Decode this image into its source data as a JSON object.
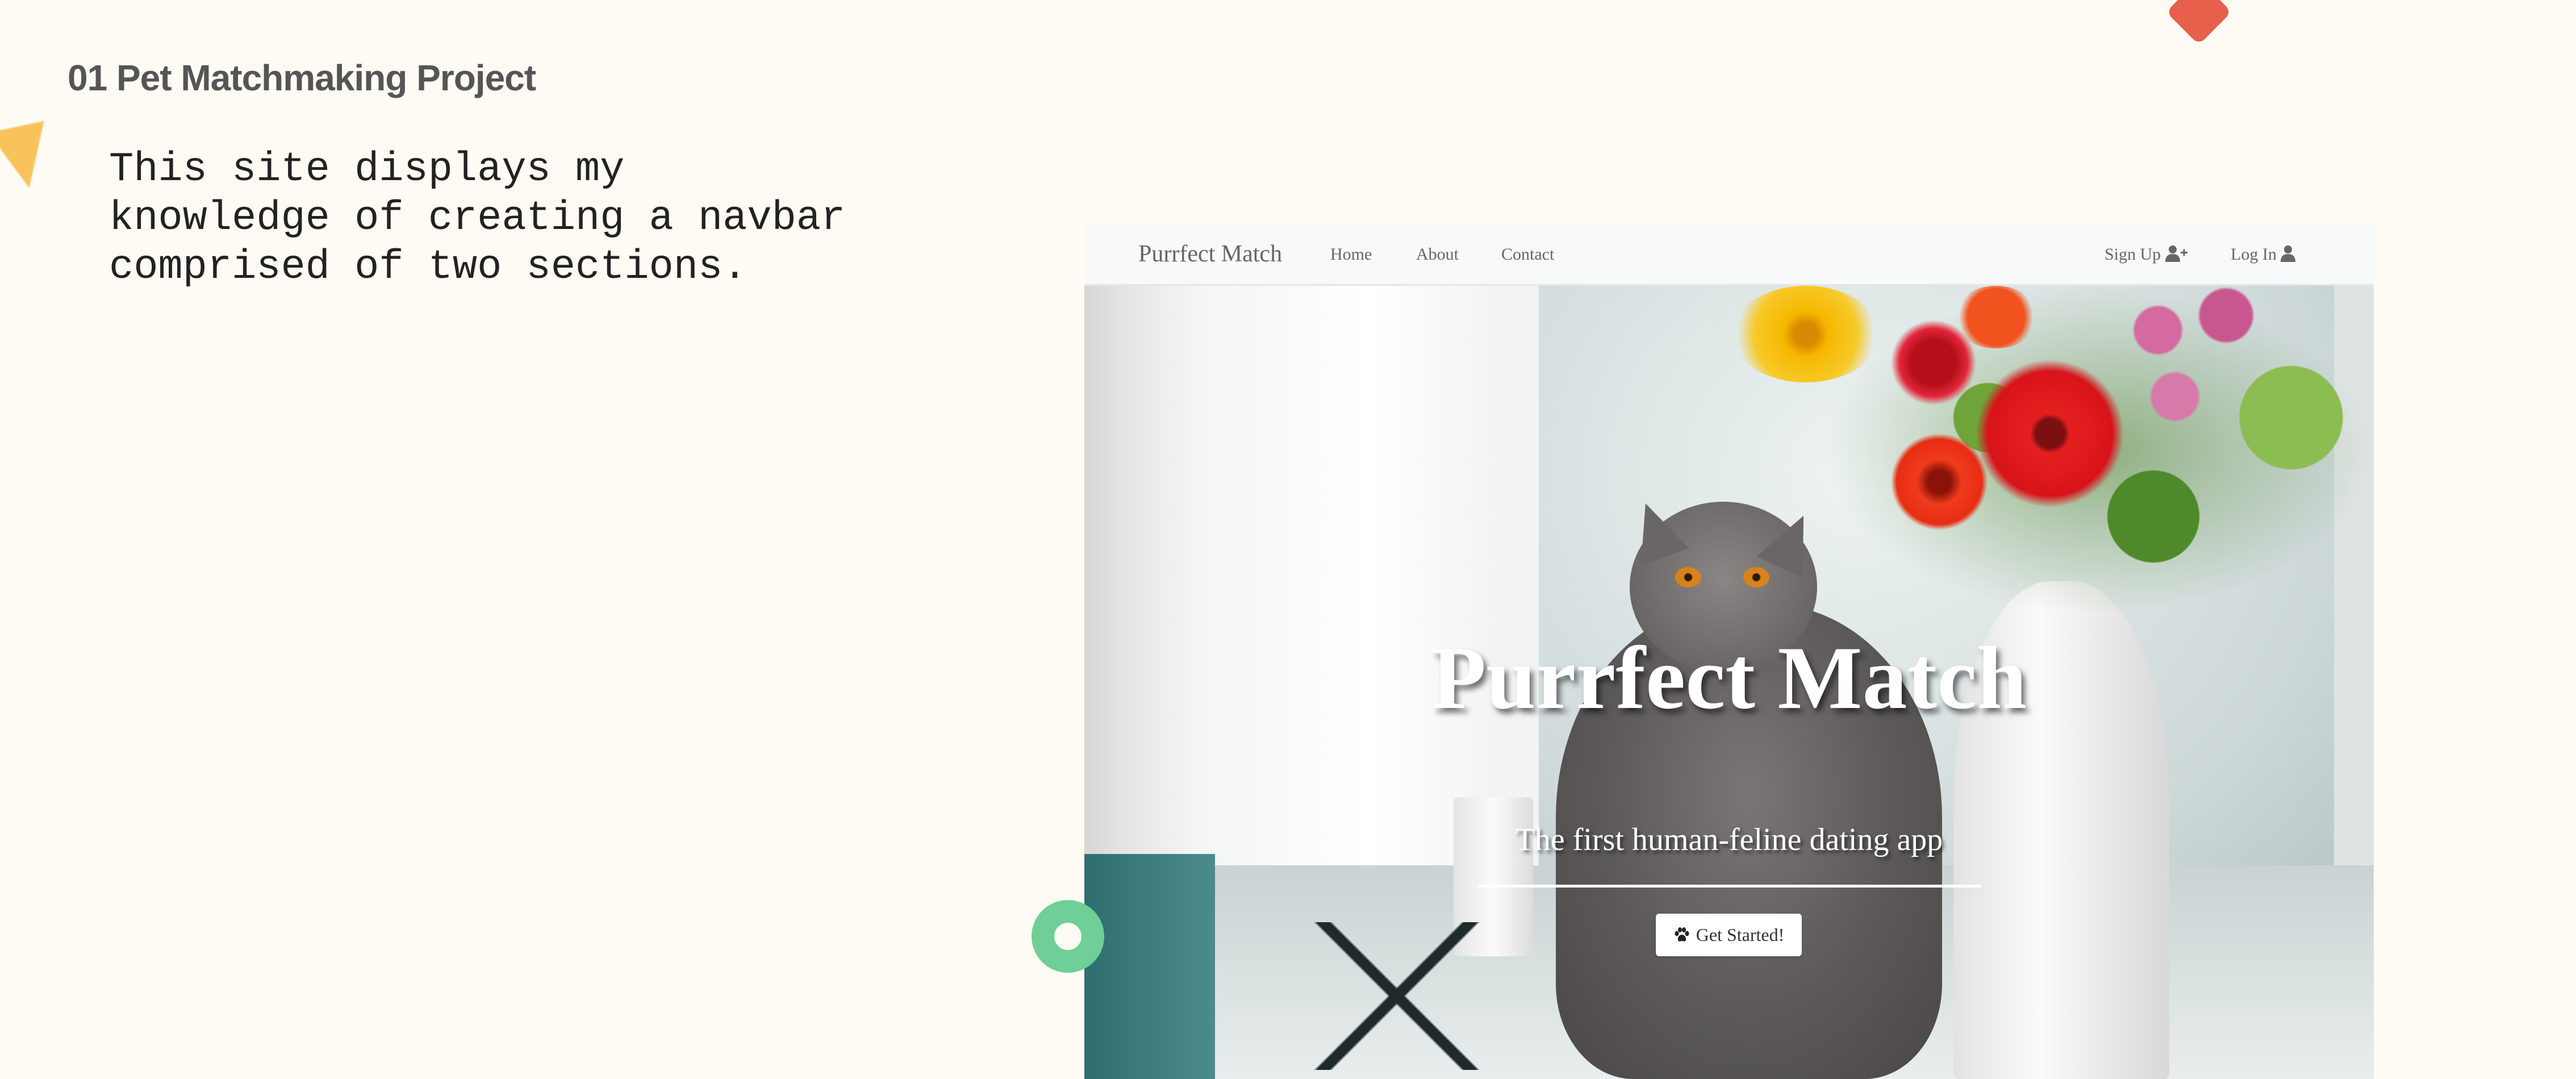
{
  "project": {
    "heading": "01 Pet Matchmaking Project",
    "description": "This site displays my\nknowledge of creating a navbar\ncomprised of two sections."
  },
  "screenshot": {
    "navbar": {
      "brand": "Purrfect Match",
      "links": [
        "Home",
        "About",
        "Contact"
      ],
      "right_links": [
        {
          "label": "Sign Up",
          "icon": "user-plus-icon"
        },
        {
          "label": "Log In",
          "icon": "user-icon"
        }
      ]
    },
    "hero": {
      "title": "Purrfect Match",
      "subtitle": "The first human-feline dating app",
      "button": {
        "label": "Get Started!",
        "icon": "paw-icon"
      }
    }
  },
  "colors": {
    "background": "#fdfbf3",
    "yellow": "#f9c35c",
    "red": "#e8604c",
    "green": "#6fcf97",
    "navbar": "#f8f9fa"
  }
}
